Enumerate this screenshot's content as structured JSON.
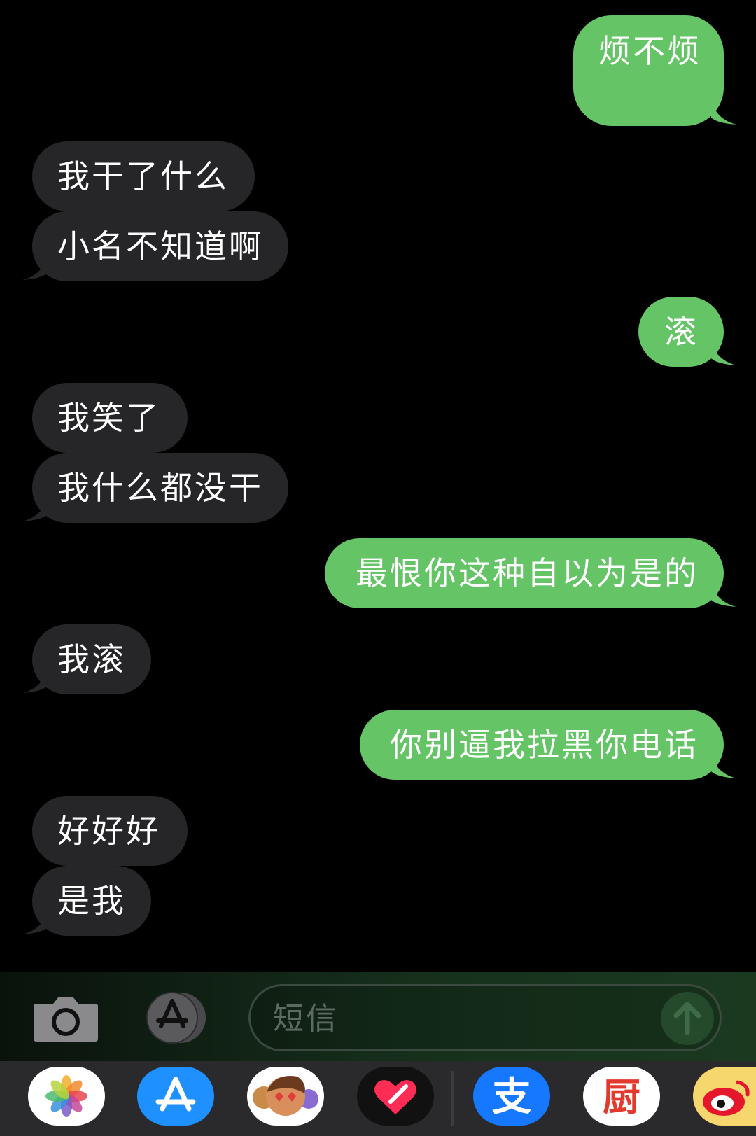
{
  "messages": [
    {
      "direction": "outgoing",
      "text": "烦不烦"
    },
    {
      "direction": "incoming",
      "text": "我干了什么"
    },
    {
      "direction": "incoming",
      "text": "小名不知道啊"
    },
    {
      "direction": "outgoing",
      "text": "滚"
    },
    {
      "direction": "incoming",
      "text": "我笑了"
    },
    {
      "direction": "incoming",
      "text": "我什么都没干"
    },
    {
      "direction": "outgoing",
      "text": "最恨你这种自以为是的"
    },
    {
      "direction": "incoming",
      "text": "我滚"
    },
    {
      "direction": "outgoing",
      "text": "你别逼我拉黑你电话"
    },
    {
      "direction": "incoming",
      "text": "好好好"
    },
    {
      "direction": "incoming",
      "text": "是我"
    }
  ],
  "composer": {
    "placeholder": "短信"
  },
  "app_drawer": {
    "apps": [
      {
        "icon": "photos-icon"
      },
      {
        "icon": "app-store-icon"
      },
      {
        "icon": "memoji-icon"
      },
      {
        "icon": "digital-touch-icon"
      },
      {
        "icon": "alipay-icon",
        "glyph": "支"
      },
      {
        "icon": "xiachufang-icon",
        "glyph": "厨"
      },
      {
        "icon": "weibo-icon"
      }
    ]
  },
  "colors": {
    "outgoing_bubble": "#65c466",
    "incoming_bubble": "#262628",
    "background": "#000000"
  }
}
